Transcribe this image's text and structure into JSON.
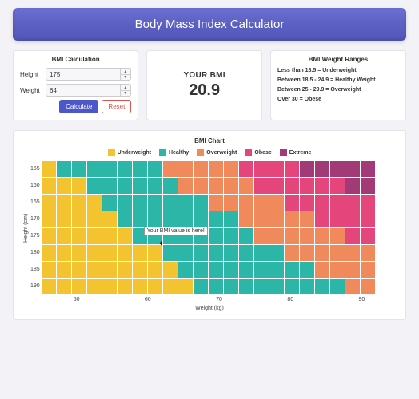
{
  "header": {
    "title": "Body Mass Index Calculator"
  },
  "calc_card": {
    "title": "BMI Calculation",
    "height_label": "Height",
    "height_value": "175",
    "weight_label": "Weight",
    "weight_value": "64",
    "calculate": "Calculate",
    "reset": "Reset"
  },
  "result": {
    "label": "YOUR BMI",
    "value": "20.9"
  },
  "ranges": {
    "title": "BMI Weight Ranges",
    "lines": [
      "Less than 18.5 = Underweight",
      "Between 18.5 - 24.9 = Healthy Weight",
      "Between 25 - 29.9 = Overweight",
      "Over 30 = Obese"
    ]
  },
  "chart_area": {
    "title": "BMI Chart",
    "legend": [
      "Underweight",
      "Healthy",
      "Overweight",
      "Obese",
      "Extreme"
    ],
    "tooltip": "Your BMI value is here!",
    "y_label": "Height (cm)",
    "x_label": "Weight (kg)"
  },
  "colors": {
    "Underweight": "#f4c430",
    "Healthy": "#2bb6a8",
    "Overweight": "#f08a5d",
    "Obese": "#e4457a",
    "Extreme": "#a33a78"
  },
  "chart_data": {
    "type": "heatmap",
    "title": "BMI Chart",
    "xlabel": "Weight (kg)",
    "ylabel": "Height (cm)",
    "y_values": [
      155,
      160,
      165,
      170,
      175,
      180,
      185,
      190
    ],
    "x_values": [
      42,
      44.5,
      47,
      49.5,
      52,
      54.5,
      57,
      59.5,
      62,
      64.5,
      67,
      69.5,
      72,
      74.5,
      77,
      79.5,
      82,
      84.5,
      87,
      89.5,
      92,
      94.5
    ],
    "x_ticks": [
      50,
      60,
      70,
      80,
      90
    ],
    "categories": [
      "Underweight",
      "Healthy",
      "Overweight",
      "Obese",
      "Extreme"
    ],
    "thresholds": [
      18.5,
      25,
      30,
      35
    ],
    "annotation": {
      "height": 175,
      "weight": 64,
      "label": "Your BMI value is here!"
    }
  }
}
